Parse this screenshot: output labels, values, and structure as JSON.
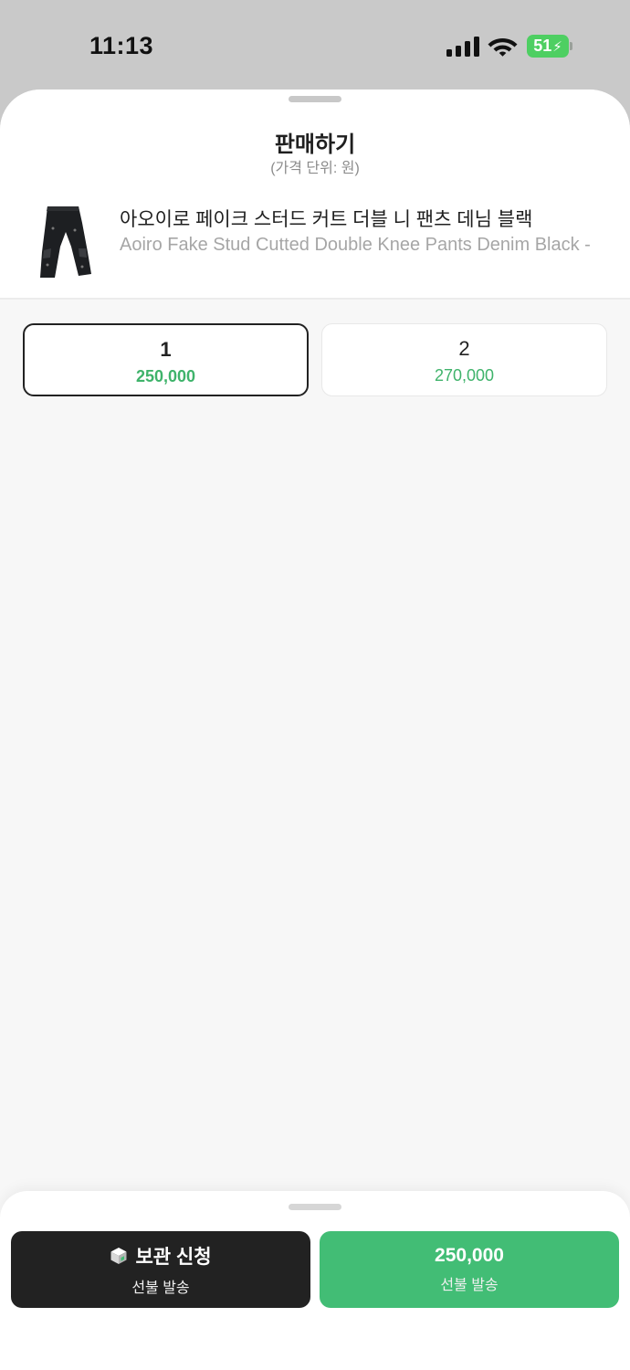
{
  "status_bar": {
    "time": "11:13",
    "battery_level": "51",
    "battery_color": "#4ecf62",
    "icons": [
      "cellular-signal-icon",
      "wifi-icon",
      "battery-charging-icon"
    ]
  },
  "sheet": {
    "title": "판매하기",
    "subtitle": "(가격 단위: 원)"
  },
  "product": {
    "image_icon": "jeans-icon",
    "name_ko": "아오이로 페이크 스터드 커트 더블 니 팬츠 데님 블랙",
    "name_en": "Aoiro Fake Stud Cutted Double Knee Pants Denim Black -"
  },
  "sizes": [
    {
      "label": "1",
      "price": "250,000",
      "selected": true
    },
    {
      "label": "2",
      "price": "270,000",
      "selected": false
    }
  ],
  "actions": {
    "storage": {
      "icon": "box-icon",
      "label": "보관 신청",
      "sub": "선불 발송",
      "color": "#222222"
    },
    "sell": {
      "label": "250,000",
      "sub": "선불 발송",
      "color": "#42bd75"
    }
  },
  "colors": {
    "accent_green": "#3fb36b",
    "sheet_background": "#f7f7f7"
  }
}
